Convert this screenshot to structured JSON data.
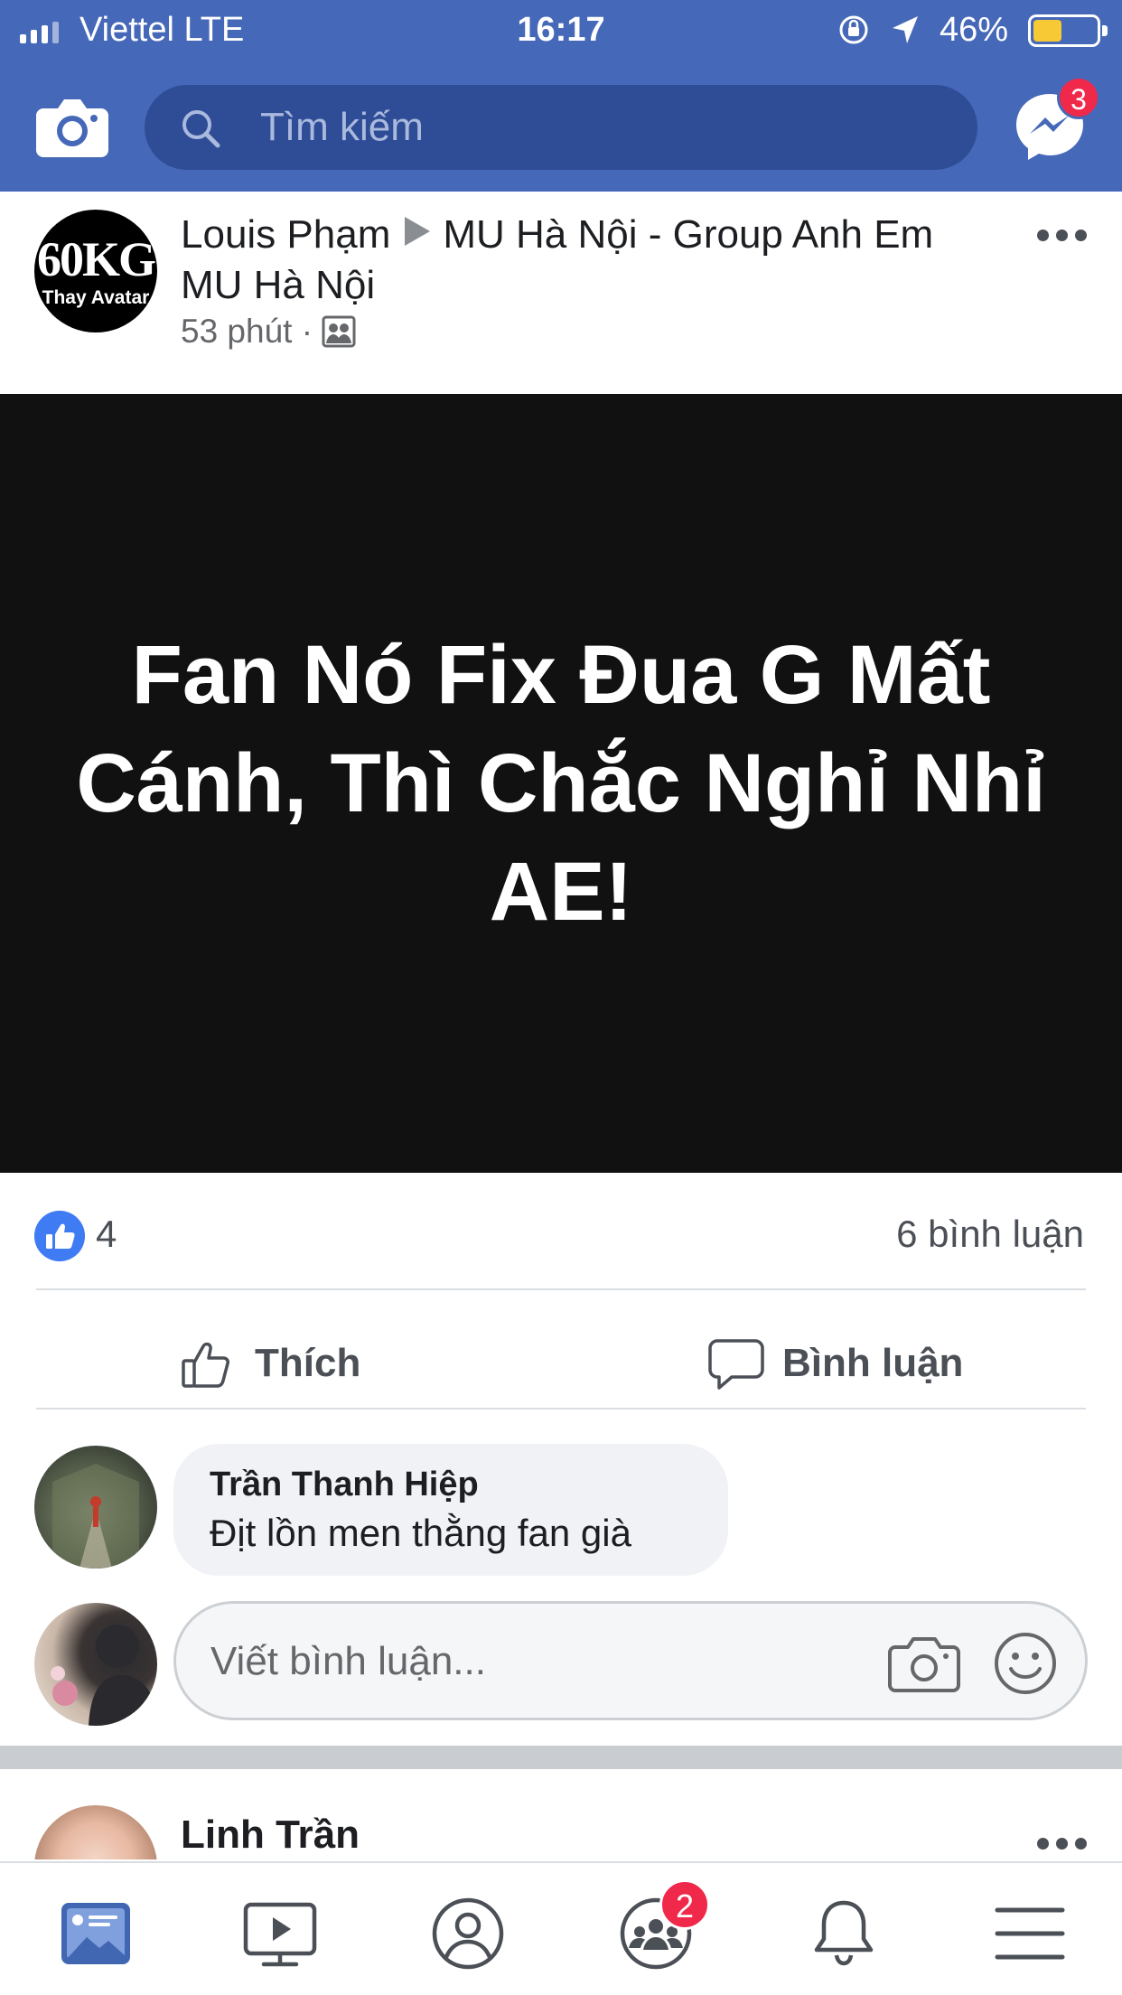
{
  "status_bar": {
    "carrier": "Viettel  LTE",
    "time": "16:17",
    "battery_percent": "46%",
    "battery_level": 0.46,
    "battery_color": "#f7c935"
  },
  "header": {
    "brand_color": "#4668b8",
    "search_placeholder": "Tìm kiếm",
    "messenger_badge": "3",
    "icons": [
      "camera-icon",
      "search-icon",
      "messenger-icon"
    ]
  },
  "post": {
    "avatar_logo_big": "60KG",
    "avatar_logo_small": "Thay Avatar",
    "author": "Louis Phạm",
    "group": "MU Hà Nội - Group Anh Em MU Hà Nội",
    "time": "53 phút ·",
    "image_caption": "Fan Nó Fix Đua G Mất Cánh, Thì Chắc Nghỉ Nhỉ AE!",
    "like_count": "4",
    "comment_count": "6 bình luận",
    "like_label": "Thích",
    "comment_label": "Bình luận"
  },
  "comment": {
    "author": "Trần Thanh Hiệp",
    "text": "Địt lồn men thằng fan già"
  },
  "write_comment": {
    "placeholder": "Viết bình luận..."
  },
  "next_post": {
    "author": "Linh Trần"
  },
  "tab_bar": {
    "tabs": [
      "news-feed-icon",
      "watch-icon",
      "profile-icon",
      "groups-icon",
      "notifications-icon",
      "menu-icon"
    ],
    "groups_badge": "2",
    "active_color": "#4267b2"
  }
}
